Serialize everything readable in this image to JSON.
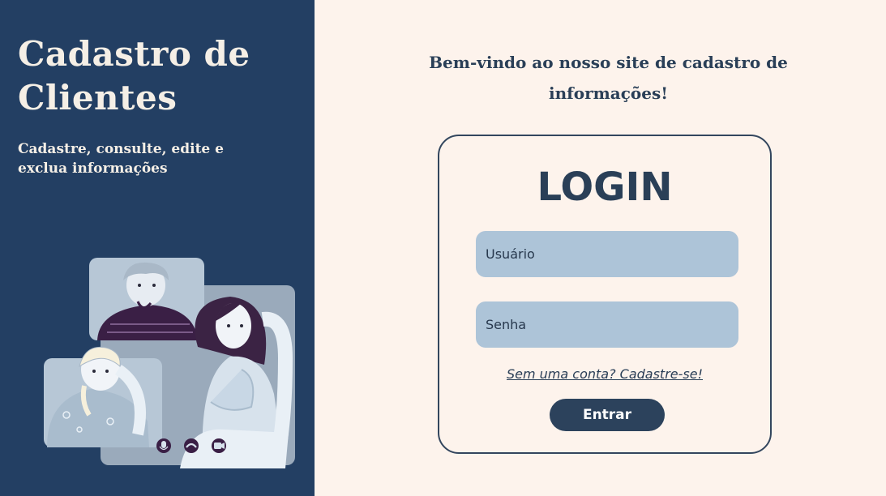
{
  "sidebar": {
    "title": "Cadastro de Clientes",
    "subtitle": "Cadastre, consulte, edite e exclua informações",
    "illustration_icons": [
      "mic-icon",
      "hangup-icon",
      "camera-icon"
    ]
  },
  "main": {
    "welcome": "Bem-vindo ao nosso site de cadastro de informações!",
    "login": {
      "title": "LOGIN",
      "username_placeholder": "Usuário",
      "password_placeholder": "Senha",
      "signup_link": "Sem uma conta? Cadastre-se!",
      "submit_label": "Entrar"
    }
  },
  "colors": {
    "sidebar_bg": "#233f63",
    "page_bg": "#fdf3ec",
    "accent": "#2c425c",
    "field_bg": "#adc4d8"
  }
}
